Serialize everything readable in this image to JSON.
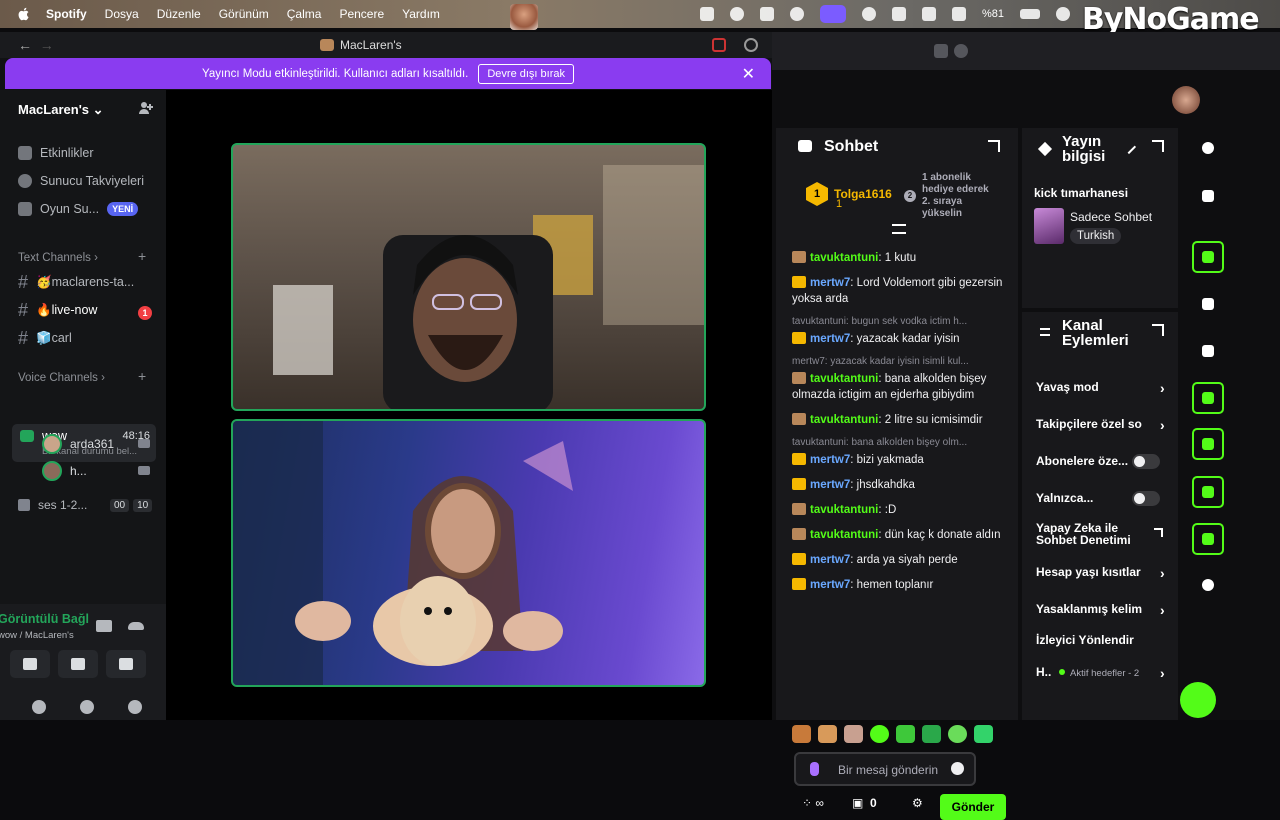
{
  "menubar": {
    "app": "Spotify",
    "menus": [
      "Dosya",
      "Düzenle",
      "Görünüm",
      "Çalma",
      "Pencere",
      "Yardım"
    ],
    "battery": "%81",
    "brand": "ByNoGame"
  },
  "discord": {
    "window_title": "MacLaren's",
    "notice_text": "Yayıncı Modu etkinleştirildi. Kullanıcı adları kısaltıldı.",
    "notice_button": "Devre dışı bırak",
    "server_name": "MacLaren's",
    "items": [
      {
        "label": "Etkinlikler"
      },
      {
        "label": "Sunucu Takviyeleri"
      },
      {
        "label": "Oyun Su...",
        "badge": "YENİ"
      }
    ],
    "text_category": "Text Channels",
    "text_channels": [
      {
        "label": "🥳maclarens-ta..."
      },
      {
        "label": "🔥live-now",
        "badge": "1"
      },
      {
        "label": "🧊carl"
      }
    ],
    "voice_category": "Voice Channels",
    "voice_active": {
      "name": "wow",
      "time": "48:16",
      "status": "Bir kanal durumu bel..."
    },
    "voice_users": [
      "arda361",
      "h..."
    ],
    "voice_other": {
      "name": "ses 1-2...",
      "count_a": "00",
      "count_b": "10"
    },
    "voice_panel": {
      "title": "Görüntülü Bağl",
      "subtitle": "wow / MacLaren's"
    }
  },
  "kick": {
    "chat": {
      "title": "Sohbet",
      "pinned_user": "Tolga1616",
      "pinned_rank": "1",
      "pinned_count": "1",
      "pinned_note": "1 abonelik hediye ederek 2. sıraya yükselin",
      "pinned_note_badge": "2",
      "messages": [
        {
          "badge": "dog",
          "user": "tavuktantuni",
          "text": "1 kutu"
        },
        {
          "badge": "crown",
          "user": "mertw7",
          "text": "Lord Voldemort gibi gezersin yoksa arda"
        },
        {
          "reply": "tavuktantuni: bugun sek vodka ictim h...",
          "badge": "crown",
          "user": "mertw7",
          "text": "yazacak kadar iyisin"
        },
        {
          "reply": "mertw7: yazacak kadar iyisin isimli kul...",
          "badge": "dog",
          "user": "tavuktantuni",
          "text": "bana alkolden bişey olmazda ictigim an ejderha gibiydim"
        },
        {
          "badge": "dog",
          "user": "tavuktantuni",
          "text": "2 litre su icmisimdir"
        },
        {
          "reply": "tavuktantuni: bana alkolden bişey olm...",
          "badge": "crown",
          "user": "mertw7",
          "text": "bizi yakmada"
        },
        {
          "badge": "crown",
          "user": "mertw7",
          "text": "jhsdkahdka"
        },
        {
          "badge": "dog",
          "user": "tavuktantuni",
          "text": ":D"
        },
        {
          "badge": "dog",
          "user": "tavuktantuni",
          "text": "dün kaç k donate aldın"
        },
        {
          "badge": "crown",
          "user": "mertw7",
          "text": "arda ya siyah perde"
        },
        {
          "badge": "crown",
          "user": "mertw7",
          "text": "hemen toplanır"
        }
      ],
      "input_placeholder": "Bir mesaj gönderin",
      "footer_count": "0",
      "send_label": "Gönder"
    },
    "stream_info": {
      "title": "Yayın bilgisi",
      "stream_title": "kick tımarhanesi",
      "category": "Sadece Sohbet",
      "tag": "Turkish"
    },
    "channel_actions": {
      "title": "Kanal Eylemleri",
      "items": [
        {
          "label": "Yavaş mod"
        },
        {
          "label": "Takipçilere özel so"
        },
        {
          "label": "Abonelere öze..."
        },
        {
          "label": "Yalnızca..."
        },
        {
          "label": "Yapay Zeka ile Sohbet Denetimi"
        },
        {
          "label": "Hesap yaşı kısıtlar"
        },
        {
          "label": "Yasaklanmış kelim"
        },
        {
          "label": "İzleyici Yönlendir"
        },
        {
          "label": "H..",
          "extra": "Aktif hedefler - 2"
        }
      ]
    }
  },
  "colors": {
    "kick_green": "#53fc18",
    "discord_purple": "#8a3cf0",
    "crown": "#f5b800"
  }
}
